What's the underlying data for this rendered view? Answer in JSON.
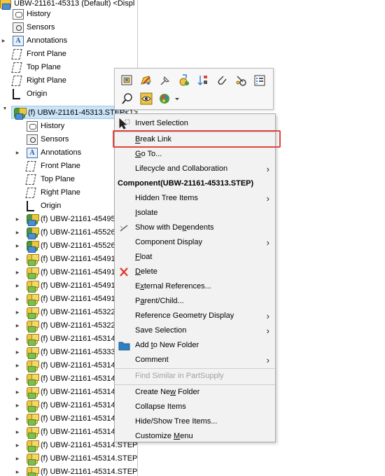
{
  "tree": {
    "root_label": "UBW-21161-45313 (Default) <Displ",
    "top_items": [
      {
        "label": "History",
        "icon": "history-icon"
      },
      {
        "label": "Sensors",
        "icon": "sensors-icon"
      },
      {
        "label": "Annotations",
        "icon": "annotations-icon"
      },
      {
        "label": "Front Plane",
        "icon": "plane-icon"
      },
      {
        "label": "Top Plane",
        "icon": "plane-icon"
      },
      {
        "label": "Right Plane",
        "icon": "plane-icon"
      },
      {
        "label": "Origin",
        "icon": "origin-icon"
      }
    ],
    "selected_item": "(f) UBW-21161-45313.STEP<1>",
    "sub_items": [
      {
        "label": "History",
        "icon": "history-icon"
      },
      {
        "label": "Sensors",
        "icon": "sensors-icon"
      },
      {
        "label": "Annotations",
        "icon": "annotations-icon"
      },
      {
        "label": "Front Plane",
        "icon": "plane-icon"
      },
      {
        "label": "Top Plane",
        "icon": "plane-icon"
      },
      {
        "label": "Right Plane",
        "icon": "plane-icon"
      },
      {
        "label": "Origin",
        "icon": "origin-icon"
      }
    ],
    "components": [
      {
        "label": "(f) UBW-21161-45495.S",
        "kind": "assembly"
      },
      {
        "label": "(f) UBW-21161-45526.S",
        "kind": "assembly"
      },
      {
        "label": "(f) UBW-21161-45526.S",
        "kind": "assembly"
      },
      {
        "label": "(f) UBW-21161-45491.S",
        "kind": "part"
      },
      {
        "label": "(f) UBW-21161-45491.S",
        "kind": "part"
      },
      {
        "label": "(f) UBW-21161-45491.S",
        "kind": "part"
      },
      {
        "label": "(f) UBW-21161-45491.S",
        "kind": "part"
      },
      {
        "label": "(f) UBW-21161-45322.S",
        "kind": "part"
      },
      {
        "label": "(f) UBW-21161-45322.S",
        "kind": "part"
      },
      {
        "label": "(f) UBW-21161-45314.S",
        "kind": "part"
      },
      {
        "label": "(f) UBW-21161-45333.S",
        "kind": "part"
      },
      {
        "label": "(f) UBW-21161-45314.S",
        "kind": "part"
      },
      {
        "label": "(f) UBW-21161-45314.S",
        "kind": "part"
      },
      {
        "label": "(f) UBW-21161-45314.S",
        "kind": "part"
      },
      {
        "label": "(f) UBW-21161-45314.S",
        "kind": "part"
      },
      {
        "label": "(f) UBW-21161-45314.S",
        "kind": "part"
      },
      {
        "label": "(f) UBW-21161-45314.S",
        "kind": "part"
      },
      {
        "label": "(f) UBW-21161-45314.STEP",
        "kind": "part"
      },
      {
        "label": "(f) UBW-21161-45314.STEP",
        "kind": "part"
      },
      {
        "label": "(f) UBW-21161-45314.STEP",
        "kind": "part"
      }
    ]
  },
  "toolbar": {
    "row1": [
      "open-part-icon",
      "edit-component-icon",
      "pin-icon",
      "rebuild-icon",
      "sort-icon",
      "attach-icon",
      "appearance-link-icon",
      "properties-icon"
    ],
    "row2": [
      "zoom-to-selection-icon",
      "hide-show-icon",
      "appearance-icon",
      "dropdown-arrow-icon"
    ]
  },
  "menu": {
    "invert_selection": "Invert Selection",
    "break_link": "Break Link",
    "go_to": "Go To...",
    "lifecycle": "Lifecycle and Collaboration",
    "header": "Component(UBW-21161-45313.STEP)",
    "hidden_tree_items": "Hidden Tree Items",
    "isolate": "Isolate",
    "show_with_dependents": "Show with Dependents",
    "component_display": "Component Display",
    "float": "Float",
    "delete": "Delete",
    "external_references": "External References...",
    "parent_child": "Parent/Child...",
    "reference_geometry_display": "Reference Geometry Display",
    "save_selection": "Save Selection",
    "add_to_new_folder": "Add to New Folder",
    "comment": "Comment",
    "find_similar": "Find Similar in PartSupply",
    "create_new_folder": "Create New Folder",
    "collapse_items": "Collapse Items",
    "hide_show_tree_items": "Hide/Show Tree Items...",
    "customize_menu": "Customize Menu"
  },
  "colors": {
    "highlight_border": "#e0453d",
    "selection_fill": "#cce4f7",
    "delete_icon": "#e0342a",
    "folder_icon": "#2f7fc1"
  }
}
